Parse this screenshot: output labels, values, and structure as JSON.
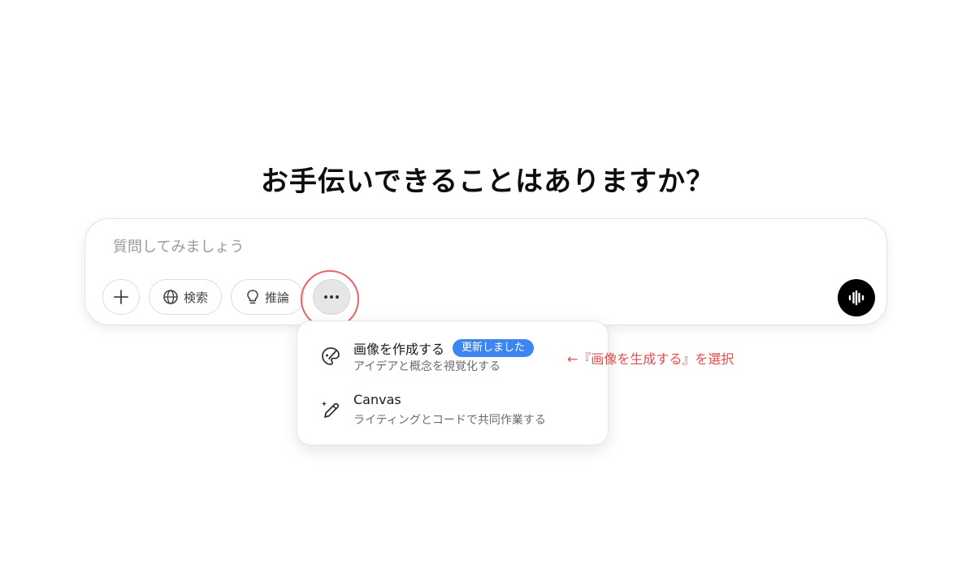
{
  "heading": "お手伝いできることはありますか？",
  "composer": {
    "placeholder": "質問してみましょう",
    "buttons": {
      "search_label": "検索",
      "reason_label": "推論"
    }
  },
  "menu": {
    "items": [
      {
        "title": "画像を作成する",
        "badge": "更新しました",
        "subtitle": "アイデアと概念を視覚化する",
        "icon": "paint-palette-icon"
      },
      {
        "title": "Canvas",
        "subtitle": "ライティングとコードで共同作業する",
        "icon": "pen-sparkle-icon"
      }
    ]
  },
  "annotation": "←『画像を生成する』を選択",
  "colors": {
    "accent_badge": "#3d86f2",
    "annotation_red": "#e5484d",
    "voice_button": "#000000"
  }
}
